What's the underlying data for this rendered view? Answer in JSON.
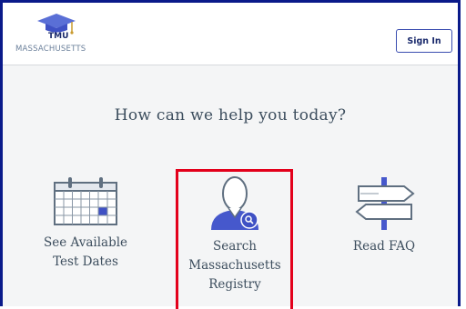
{
  "header": {
    "logo_acronym": "TMU",
    "logo_state": "MASSACHUSETTS",
    "signin_label": "Sign In"
  },
  "main": {
    "headline": "How can we help you today?",
    "options": [
      {
        "label_line1": "See Available",
        "label_line2": "Test Dates",
        "icon": "calendar-icon"
      },
      {
        "label_line1": "Search",
        "label_line2": "Massachusetts",
        "label_line3": "Registry",
        "icon": "user-search-icon",
        "highlighted": true
      },
      {
        "label_line1": "Read FAQ",
        "icon": "signpost-icon"
      }
    ]
  },
  "colors": {
    "frame": "#0a1a8a",
    "accent": "#3f51c4",
    "highlight": "#e3001b",
    "text": "#3d4e5e"
  }
}
